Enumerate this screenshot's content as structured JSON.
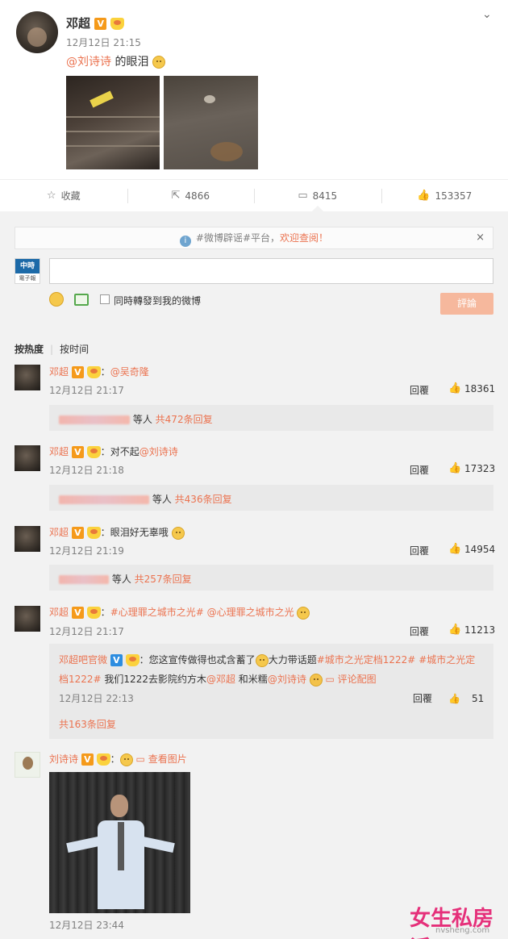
{
  "post": {
    "author": "邓超",
    "v_badge": "V",
    "time": "12月12日 21:15",
    "mention": "@刘诗诗",
    "text": " 的眼泪",
    "chevron": "⌄"
  },
  "actions": [
    {
      "icon": "☆",
      "label": "收藏"
    },
    {
      "icon": "⇱",
      "label": "4866"
    },
    {
      "icon": "▭",
      "label": "8415"
    },
    {
      "icon": "👍",
      "label": "153357"
    }
  ],
  "notice": {
    "prefix": "#微博辟谣#平台，",
    "link": "欢迎查阅！",
    "info": "i",
    "close": "×"
  },
  "composer": {
    "logo_top": "中時",
    "logo_bottom": "電子報",
    "input_value": "",
    "repost_label": "同時轉發到我的微博",
    "submit_label": "評論"
  },
  "sort": {
    "hot": "按热度",
    "time": "按时间"
  },
  "comments": [
    {
      "name": "邓超",
      "colon": "：",
      "mention": "@吴奇隆",
      "text": "",
      "time": "12月12日 21:17",
      "reply": "回覆",
      "likes": "18361",
      "sub_suffix": "等人",
      "sub_count": "共472条回复"
    },
    {
      "name": "邓超",
      "colon": "：",
      "mention": "@刘诗诗",
      "text": "对不起",
      "time": "12月12日 21:18",
      "reply": "回覆",
      "likes": "17323",
      "sub_suffix": "等人",
      "sub_count": "共436条回复"
    },
    {
      "name": "邓超",
      "colon": "：",
      "mention": "",
      "text": "眼泪好无辜哦",
      "time": "12月12日 21:19",
      "reply": "回覆",
      "likes": "14954",
      "sub_suffix": "等人",
      "sub_count": "共257条回复"
    },
    {
      "name": "邓超",
      "colon": "：",
      "mention": "#心理罪之城市之光# @心理罪之城市之光",
      "text": "",
      "time": "12月12日 21:17",
      "reply": "回覆",
      "likes": "11213"
    }
  ],
  "nested_reply": {
    "name": "邓超吧官微",
    "v_badge": "V",
    "text1": "：您这宣传做得也忒含蓄了",
    "text2": "大力带话题",
    "tag1": "#城市之光定档1222#",
    "tag2": "#城市之光定档1222#",
    "text3": " 我们1222去影院约方木",
    "mention1": "@邓超",
    "text4": " 和米糯",
    "mention2": "@刘诗诗",
    "pic_link": "评论配图",
    "time": "12月12日 22:13",
    "reply": "回覆",
    "likes": "51",
    "total": "共163条回复"
  },
  "liu_comment": {
    "name": "刘诗诗",
    "colon": "：",
    "pic_link": "查看图片",
    "time": "12月12日 23:44"
  },
  "watermark": {
    "main": "女生私房话",
    "sub": "nvsheng.com"
  }
}
